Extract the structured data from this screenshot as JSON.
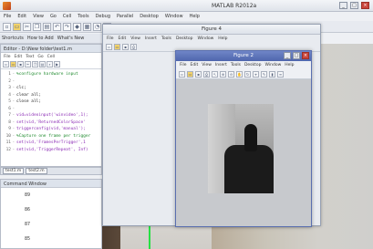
{
  "app": {
    "title": "MATLAB R2012a"
  },
  "menubar": [
    "File",
    "Edit",
    "View",
    "Go",
    "Cell",
    "Tools",
    "Debug",
    "Parallel",
    "Desktop",
    "Window",
    "Help"
  ],
  "shortcuts": {
    "label": "Shortcuts",
    "how_to_add": "How to Add",
    "whats_new": "What's New"
  },
  "editor": {
    "title": "Editor - D:\\New folder\\test1.m",
    "menu": [
      "File",
      "Edit",
      "Text",
      "Go",
      "Cell"
    ],
    "lines": [
      {
        "n": "1",
        "text": "%configure hardware input",
        "kind": "comment"
      },
      {
        "n": "2",
        "text": "",
        "kind": "normal"
      },
      {
        "n": "3",
        "text": "clc;",
        "kind": "normal"
      },
      {
        "n": "4",
        "text": "clear all;",
        "kind": "normal"
      },
      {
        "n": "5",
        "text": "close all;",
        "kind": "normal"
      },
      {
        "n": "6",
        "text": "",
        "kind": "normal"
      },
      {
        "n": "7",
        "text": "vid=videoinput('winvideo',1);",
        "kind": "str"
      },
      {
        "n": "8",
        "text": "set(vid,'ReturnedColorSpace'",
        "kind": "str"
      },
      {
        "n": "9",
        "text": "triggerconfig(vid,'manual');",
        "kind": "str"
      },
      {
        "n": "10",
        "text": "%Capture one frame per trigger",
        "kind": "comment"
      },
      {
        "n": "11",
        "text": "set(vid,'FramesPerTrigger',1",
        "kind": "str"
      },
      {
        "n": "12",
        "text": "set(vid,'TriggerRepeat', Inf)",
        "kind": "str"
      }
    ],
    "tabs": [
      "test1.m",
      "test2.m"
    ]
  },
  "command_window": {
    "title": "Command Window",
    "values": [
      "89",
      "86",
      "87",
      "85"
    ]
  },
  "figure4": {
    "title": "Figure 4",
    "menu": [
      "File",
      "Edit",
      "View",
      "Insert",
      "Tools",
      "Desktop",
      "Window",
      "Help"
    ]
  },
  "figure2": {
    "title": "Figure 2",
    "menu": [
      "File",
      "Edit",
      "View",
      "Insert",
      "Tools",
      "Desktop",
      "Window",
      "Help"
    ]
  },
  "colors": {
    "accent": "#4f66ad",
    "green_box": "#27e043"
  }
}
